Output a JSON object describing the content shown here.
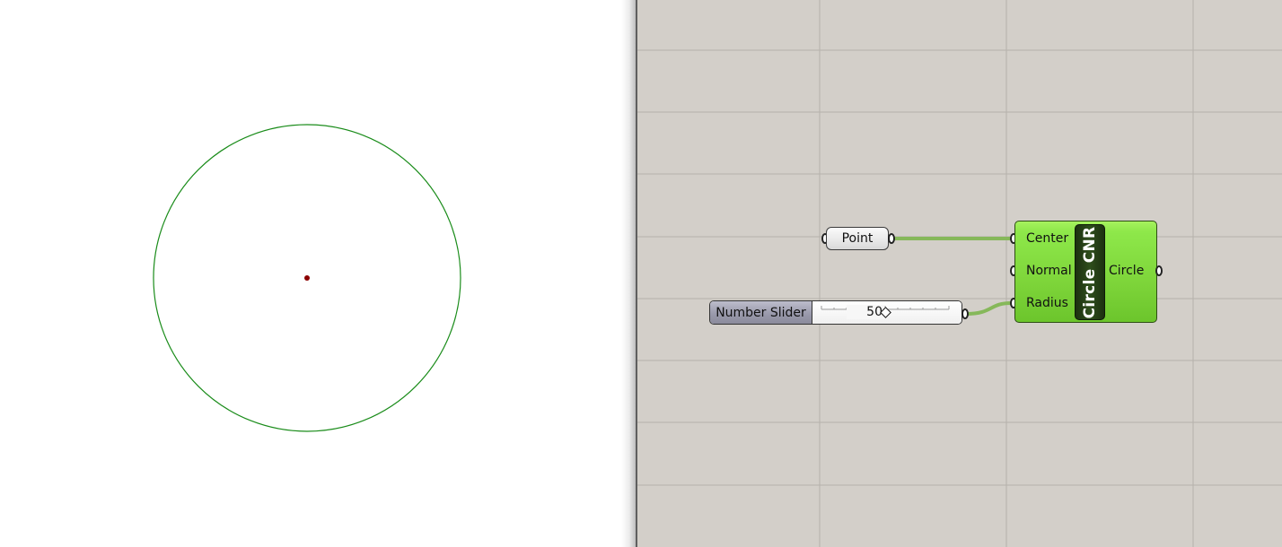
{
  "viewport": {
    "curve_color": "#1a8c1a",
    "point_color": "#8b0000"
  },
  "canvas": {
    "background": "#d3cfc9",
    "wire_color": "#86b85a"
  },
  "point_param": {
    "label": "Point"
  },
  "number_slider": {
    "label": "Number Slider",
    "value": "50",
    "position_fraction": 0.5
  },
  "circle_component": {
    "name": "Circle CNR",
    "inputs": [
      {
        "label": "Center"
      },
      {
        "label": "Normal"
      },
      {
        "label": "Radius"
      }
    ],
    "outputs": [
      {
        "label": "Circle"
      }
    ],
    "color": "#7ed53a"
  }
}
